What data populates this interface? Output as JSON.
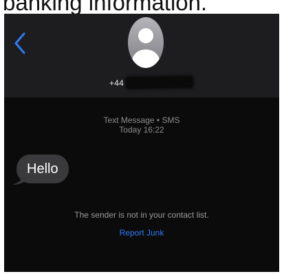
{
  "caption": {
    "text": "banking information."
  },
  "header": {
    "back_icon": "chevron-left-icon",
    "avatar_icon": "person-avatar-icon",
    "phone_prefix": "+44"
  },
  "thread": {
    "service_label": "Text Message • SMS",
    "timestamp": "Today 16:22",
    "messages": [
      {
        "direction": "incoming",
        "text": "Hello"
      }
    ],
    "notice": "The sender is not in your contact list.",
    "report_link": "Report Junk"
  },
  "colors": {
    "background": "#0b0b0b",
    "header": "#1d1d1f",
    "incoming_bubble": "#3a3a3c",
    "link": "#2f7bf6",
    "back_chevron": "#2f7bf6"
  }
}
